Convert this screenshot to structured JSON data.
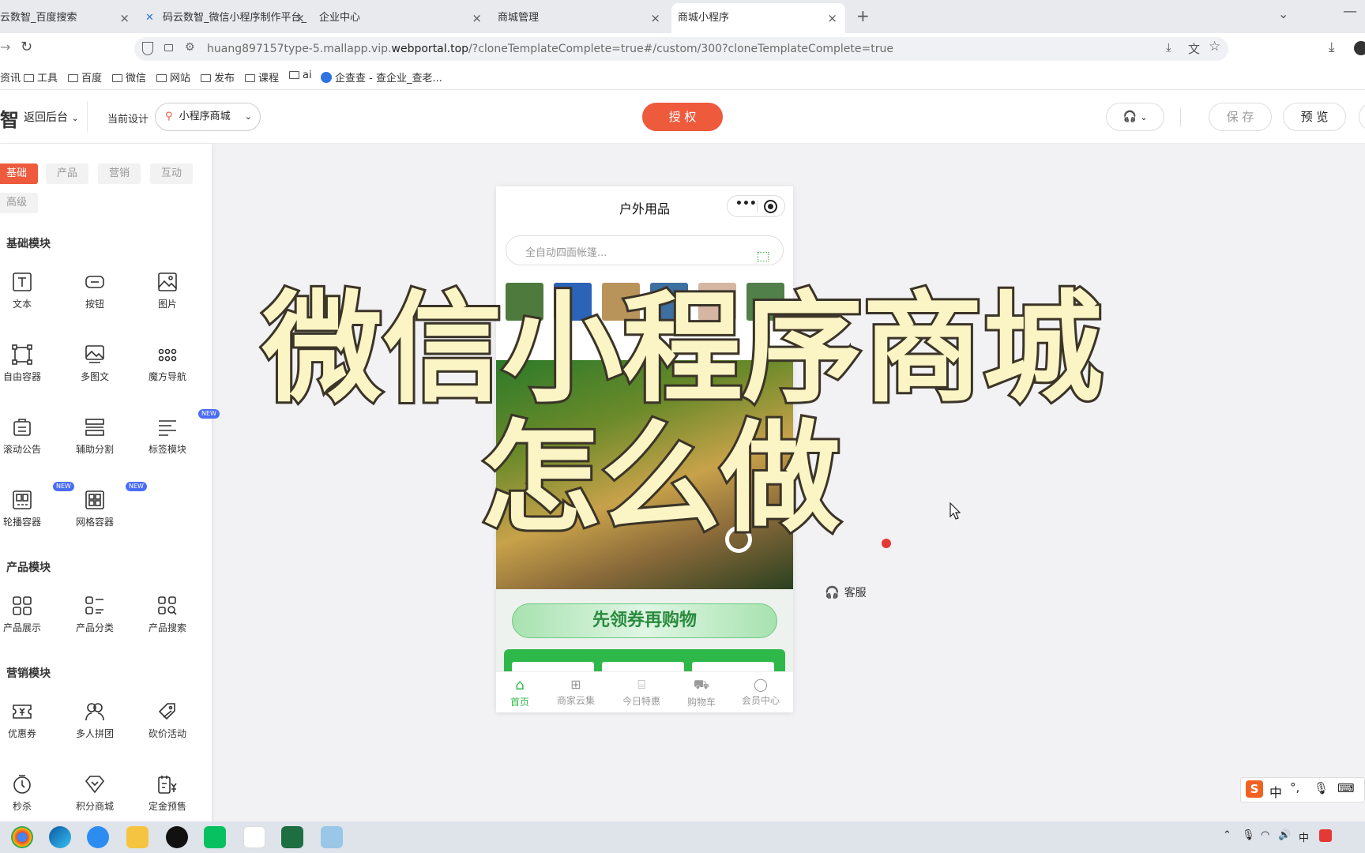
{
  "browser": {
    "tabs": [
      {
        "title": "云数智_百度搜索",
        "close": "×"
      },
      {
        "title": "码云数智_微信小程序制作平台_",
        "close": "×"
      },
      {
        "title": "企业中心",
        "close": "×"
      },
      {
        "title": "商城管理",
        "close": "×"
      },
      {
        "title": "商城小程序",
        "close": "×",
        "active": true
      }
    ],
    "new_tab": "+",
    "url_domain_prefix": "huang897157type-5.mallapp.vip.",
    "url_domain_main": "webportal.top",
    "url_rest": "/?cloneTemplateComplete=true#/custom/300?cloneTemplateComplete=true",
    "bookmarks": [
      "资讯",
      "工具",
      "百度",
      "微信",
      "网站",
      "发布",
      "课程",
      "ai",
      "企查查 - 查企业_查老..."
    ]
  },
  "editor": {
    "logo": "智",
    "back_label": "返回后台",
    "current_design_label": "当前设计",
    "design_select": "小程序商城",
    "authorize_button": "授 权",
    "save_button": "保 存",
    "preview_button": "预 览",
    "accent": "#ee5a3c"
  },
  "left_panel": {
    "categories": [
      "基础",
      "产品",
      "营销",
      "互动",
      "高级"
    ],
    "sections": [
      {
        "title": "基础模块",
        "items": [
          {
            "label": "文本",
            "icon": "text-icon"
          },
          {
            "label": "按钮",
            "icon": "button-icon"
          },
          {
            "label": "图片",
            "icon": "image-icon"
          },
          {
            "label": "自由容器",
            "icon": "free-container-icon"
          },
          {
            "label": "多图文",
            "icon": "multi-image-icon"
          },
          {
            "label": "魔方导航",
            "icon": "cube-nav-icon"
          },
          {
            "label": "滚动公告",
            "icon": "notice-icon"
          },
          {
            "label": "辅助分割",
            "icon": "divider-icon"
          },
          {
            "label": "标签模块",
            "icon": "tag-icon",
            "badge": "NEW"
          },
          {
            "label": "轮播容器",
            "icon": "carousel-icon",
            "badge": "NEW"
          },
          {
            "label": "网格容器",
            "icon": "grid-icon",
            "badge": "NEW"
          }
        ]
      },
      {
        "title": "产品模块",
        "items": [
          {
            "label": "产品展示",
            "icon": "product-display-icon"
          },
          {
            "label": "产品分类",
            "icon": "product-category-icon"
          },
          {
            "label": "产品搜索",
            "icon": "product-search-icon"
          }
        ]
      },
      {
        "title": "营销模块",
        "items": [
          {
            "label": "优惠券",
            "icon": "coupon-icon"
          },
          {
            "label": "多人拼团",
            "icon": "group-buy-icon"
          },
          {
            "label": "砍价活动",
            "icon": "bargain-icon"
          },
          {
            "label": "秒杀",
            "icon": "flash-sale-icon"
          },
          {
            "label": "积分商城",
            "icon": "points-mall-icon"
          },
          {
            "label": "定金预售",
            "icon": "presale-icon"
          }
        ]
      }
    ]
  },
  "phone": {
    "title": "户外用品",
    "search_placeholder": "全自动四面帐篷...",
    "coupon_banner": "先领券再购物",
    "tabbar": [
      {
        "label": "首页",
        "icon": "home-icon",
        "active": true
      },
      {
        "label": "商家云集",
        "icon": "grid-icon"
      },
      {
        "label": "今日特惠",
        "icon": "gift-icon"
      },
      {
        "label": "购物车",
        "icon": "cart-icon"
      },
      {
        "label": "会员中心",
        "icon": "user-icon"
      }
    ],
    "green": "#2fb84a"
  },
  "side_float": {
    "service_label": "客服"
  },
  "overlay": {
    "line1": "微信小程序商城",
    "line2": "怎么做"
  },
  "ime": {
    "lang": "中",
    "punct": "°,"
  },
  "tray": {
    "lang": "中"
  }
}
